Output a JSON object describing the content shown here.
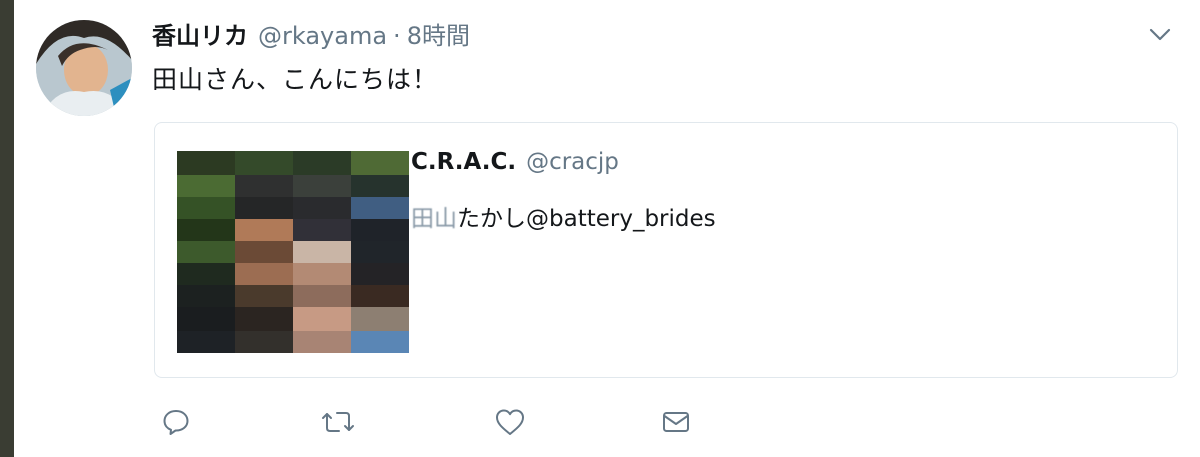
{
  "tweet": {
    "display_name": "香山リカ",
    "handle": "@rkayama",
    "separator": "·",
    "time": "8時間",
    "text": "田山さん、こんにちは！"
  },
  "quoted": {
    "display_name": "C.R.A.C.",
    "handle": "@cracjp",
    "text_prefix": "田山",
    "text_rest": "たかし@battery_brides"
  },
  "icons": {
    "caret": "chevron-down-icon",
    "reply": "reply-icon",
    "retweet": "retweet-icon",
    "like": "heart-icon",
    "dm": "envelope-icon"
  },
  "colors": {
    "text_primary": "#14171a",
    "text_secondary": "#657786",
    "border": "#e1e8ed",
    "icon": "#657786"
  }
}
